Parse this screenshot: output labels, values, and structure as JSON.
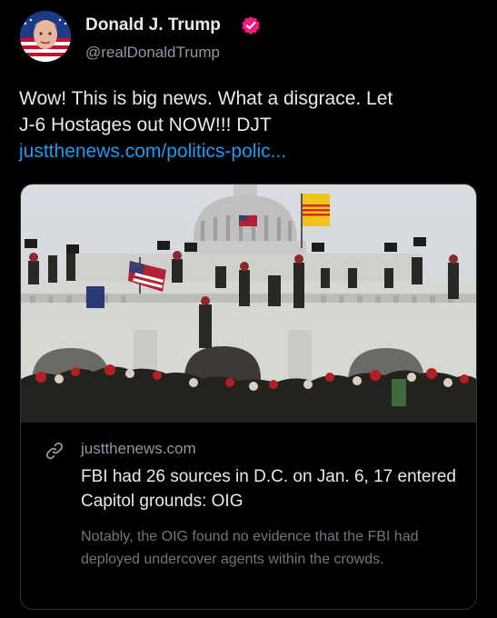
{
  "author": {
    "display_name": "Donald J. Trump",
    "handle": "@realDonaldTrump",
    "verified_color": "#f91880",
    "avatar_icon": "american-flag-portrait-avatar"
  },
  "tweet": {
    "text_line1": "Wow! This is big news. What a disgrace. Let",
    "text_line2": "J-6 Hostages out NOW!!! DJT",
    "link_text": "justthenews.com/politics-polic..."
  },
  "card": {
    "image_icon": "capitol-building-crowd-photo",
    "domain": "justthenews.com",
    "title": "FBI had 26 sources in D.C. on Jan. 6, 17 entered Capitol grounds: OIG",
    "description": "Notably, the OIG found no evidence that the FBI had deployed undercover agents within the crowds."
  },
  "colors": {
    "background": "#000000",
    "text": "#e7e9ea",
    "secondary_text": "#8b98a5",
    "link": "#1d9bf0",
    "card_border": "#2f3336"
  }
}
